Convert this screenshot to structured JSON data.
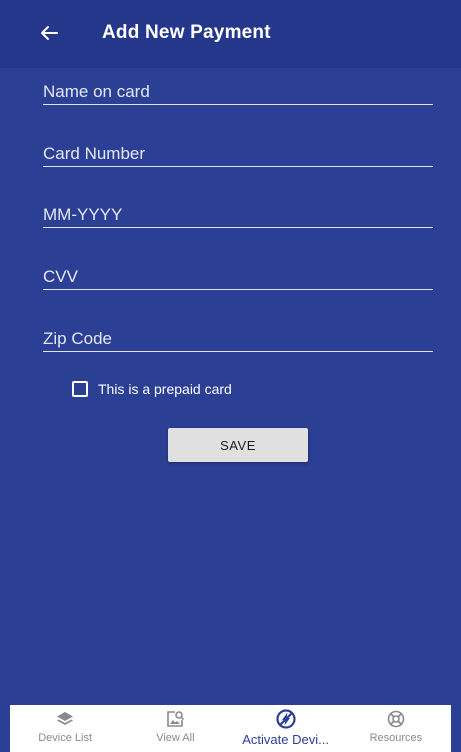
{
  "header": {
    "title": "Add New Payment",
    "back_icon": "arrow-left-icon"
  },
  "form": {
    "name_placeholder": "Name on card",
    "card_number_placeholder": "Card Number",
    "expiry_placeholder": "MM-YYYY",
    "cvv_placeholder": "CVV",
    "zip_placeholder": "Zip Code",
    "prepaid_label": "This is a prepaid card",
    "prepaid_checked": false,
    "save_label": "SAVE"
  },
  "bottom_nav": {
    "items": [
      {
        "label": "Device List",
        "icon": "layers-icon",
        "active": false
      },
      {
        "label": "View All",
        "icon": "image-search-icon",
        "active": false
      },
      {
        "label": "Activate Devi...",
        "icon": "lightning-icon",
        "active": true
      },
      {
        "label": "Resources",
        "icon": "lifebuoy-icon",
        "active": false
      }
    ]
  },
  "colors": {
    "background": "#2b3f94",
    "appbar": "#24378a",
    "button": "#e0e0e0",
    "active_nav": "#2b3f94"
  }
}
